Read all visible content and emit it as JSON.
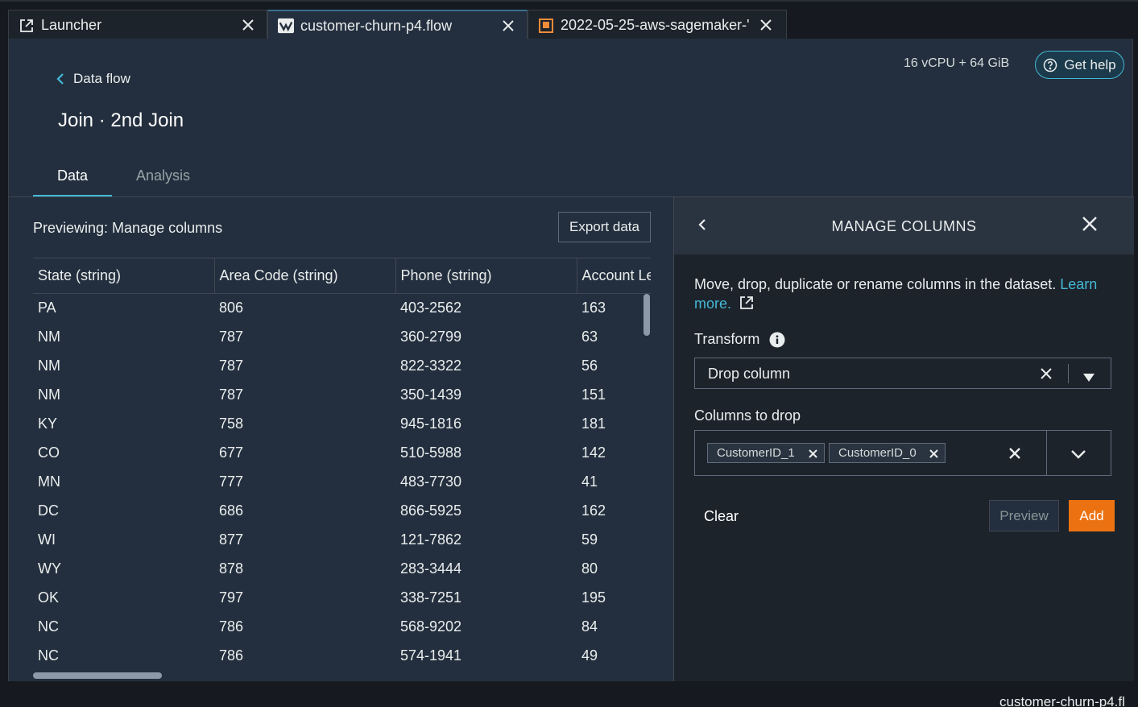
{
  "tabs": [
    {
      "label": "Launcher",
      "icon": "external-link-icon"
    },
    {
      "label": "customer-churn-p4.flow",
      "icon": "flow-icon",
      "active": true
    },
    {
      "label": "2022-05-25-aws-sagemaker-'",
      "icon": "notebook-icon"
    }
  ],
  "header": {
    "back_label": "Data flow",
    "title": "Join · 2nd Join",
    "resource": "16 vCPU + 64 GiB",
    "help_label": "Get help"
  },
  "view_tabs": [
    "Data",
    "Analysis"
  ],
  "preview": {
    "label": "Previewing: Manage columns",
    "export_label": "Export data"
  },
  "table": {
    "columns": [
      "State (string)",
      "Area Code (string)",
      "Phone (string)",
      "Account Le"
    ],
    "rows": [
      [
        "PA",
        "806",
        "403-2562",
        "163"
      ],
      [
        "NM",
        "787",
        "360-2799",
        "63"
      ],
      [
        "NM",
        "787",
        "822-3322",
        "56"
      ],
      [
        "NM",
        "787",
        "350-1439",
        "151"
      ],
      [
        "KY",
        "758",
        "945-1816",
        "181"
      ],
      [
        "CO",
        "677",
        "510-5988",
        "142"
      ],
      [
        "MN",
        "777",
        "483-7730",
        "41"
      ],
      [
        "DC",
        "686",
        "866-5925",
        "162"
      ],
      [
        "WI",
        "877",
        "121-7862",
        "59"
      ],
      [
        "WY",
        "878",
        "283-3444",
        "80"
      ],
      [
        "OK",
        "797",
        "338-7251",
        "195"
      ],
      [
        "NC",
        "786",
        "568-9202",
        "84"
      ],
      [
        "NC",
        "786",
        "574-1941",
        "49"
      ]
    ]
  },
  "panel": {
    "title": "MANAGE COLUMNS",
    "description": "Move, drop, duplicate or rename columns in the dataset.",
    "learn_more": "Learn more.",
    "transform_label": "Transform",
    "transform_value": "Drop column",
    "columns_label": "Columns to drop",
    "chips": [
      "CustomerID_1",
      "CustomerID_0"
    ],
    "clear_label": "Clear",
    "preview_label": "Preview",
    "add_label": "Add"
  },
  "status_bar": {
    "text": "customer-churn-p4.fl"
  },
  "colors": {
    "accent": "#44b9d6",
    "primary_button": "#ec7211",
    "background": "#232f3e",
    "panel": "#1d232b"
  }
}
